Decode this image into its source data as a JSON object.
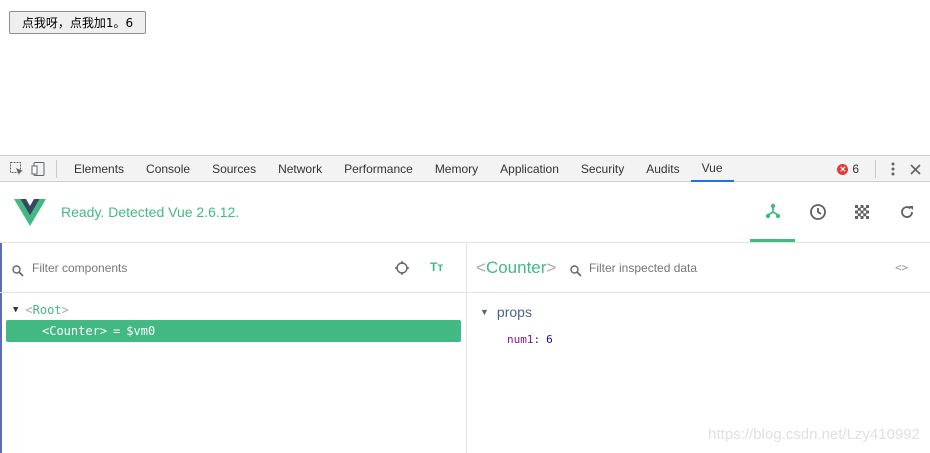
{
  "page": {
    "button_label": "点我呀，点我加1。6"
  },
  "devtools": {
    "tabs": [
      "Elements",
      "Console",
      "Sources",
      "Network",
      "Performance",
      "Memory",
      "Application",
      "Security",
      "Audits",
      "Vue"
    ],
    "active_tab": "Vue",
    "error_count": "6"
  },
  "vue": {
    "status": "Ready. Detected Vue 2.6.12.",
    "accent_color": "#42b983",
    "header_buttons": [
      "components-icon",
      "history-icon",
      "vuex-icon",
      "refresh-icon"
    ]
  },
  "left": {
    "filter_placeholder": "Filter components",
    "tt_label": "Tт",
    "root": {
      "open": "<",
      "name": "Root",
      "close": ">"
    },
    "selected": {
      "open": "<",
      "name": "Counter",
      "close": ">",
      "eq": "=",
      "ref": "$vm0"
    }
  },
  "right": {
    "title_open": "<",
    "title_name": "Counter",
    "title_close": ">",
    "filter_placeholder": "Filter inspected data",
    "code_label": "<>",
    "section": "props",
    "props": [
      {
        "key": "num1",
        "value": "6"
      }
    ]
  },
  "watermark": "https://blog.csdn.net/Lzy410992"
}
